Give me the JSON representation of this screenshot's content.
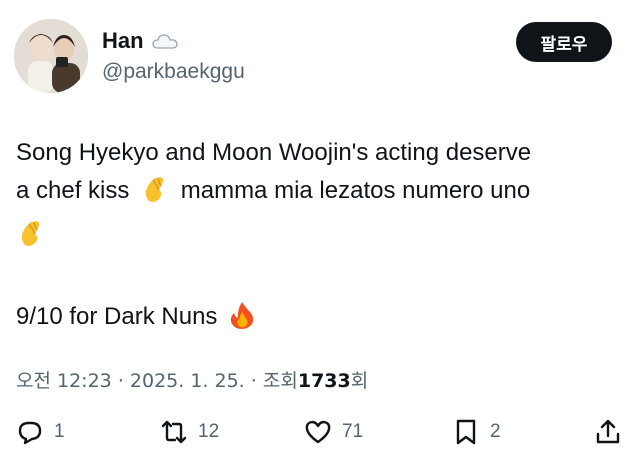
{
  "author": {
    "display_name": "Han",
    "handle": "@parkbaekggu",
    "badge_icon": "cloud-icon"
  },
  "follow_button": {
    "label": "팔로우"
  },
  "tweet": {
    "line1": "Song Hyekyo and Moon Woojin's acting deserve",
    "line2_a": "a chef kiss",
    "line2_b": "mamma mia lezatos numero uno",
    "line3": "",
    "line5": "9/10 for Dark Nuns",
    "emojis": [
      "pinched-fingers-emoji",
      "pinched-fingers-emoji",
      "fire-emoji"
    ]
  },
  "meta": {
    "time": "오전 12:23",
    "sep1": "·",
    "date": "2025. 1. 25.",
    "sep2": "·",
    "views_prefix": "조회",
    "views_count": "1733",
    "views_suffix": "회"
  },
  "actions": {
    "replies": "1",
    "retweets": "12",
    "likes": "71",
    "bookmarks": "2"
  },
  "colors": {
    "text": "#0f1419",
    "secondary": "#536471",
    "button_bg": "#0f1419"
  }
}
